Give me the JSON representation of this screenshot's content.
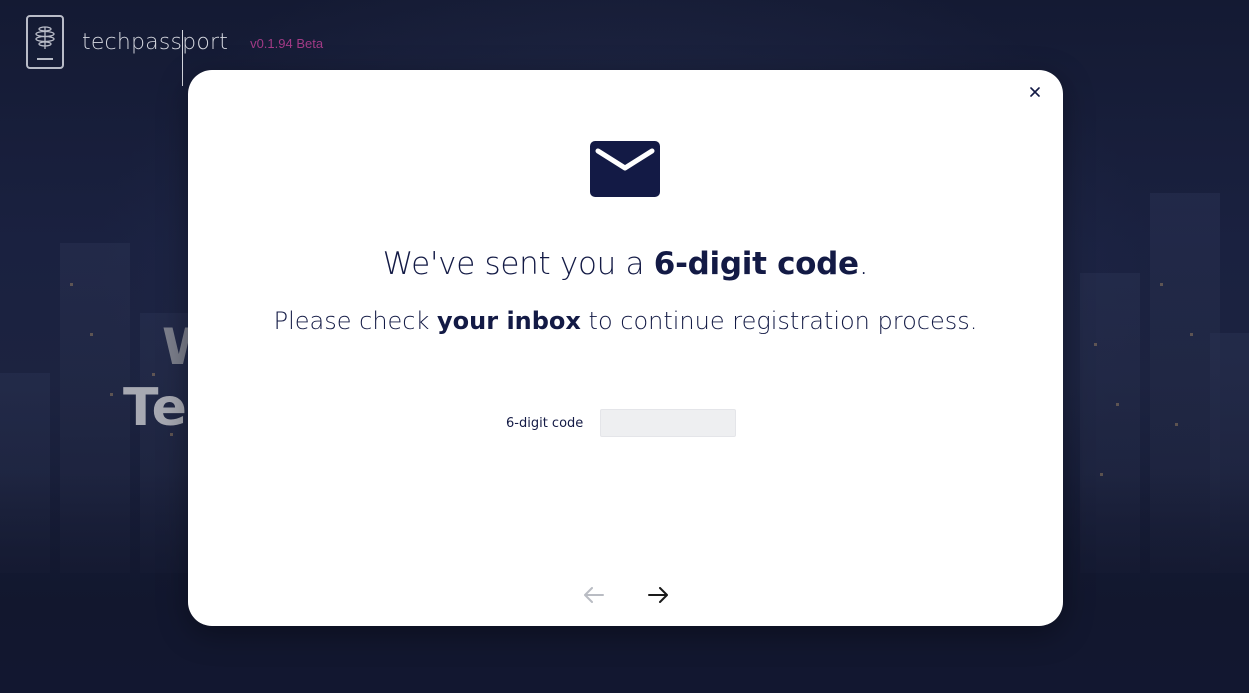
{
  "header": {
    "brand": "techpassport",
    "version": "v0.1.94 Beta",
    "logo_icon": "passport-logo-icon"
  },
  "hero": {
    "line1": "W",
    "line2": "Te"
  },
  "modal": {
    "close_icon": "close-icon",
    "mail_icon": "envelope-icon",
    "headline_pre": "We've sent you a ",
    "headline_bold": "6-digit code",
    "headline_post": ".",
    "sub_pre": "Please check ",
    "sub_bold": "your inbox",
    "sub_post": " to continue registration process.",
    "code_label": "6-digit code",
    "code_value": "",
    "code_placeholder": "",
    "prev_icon": "arrow-left-icon",
    "next_icon": "arrow-right-icon"
  },
  "colors": {
    "brand_navy": "#131a45",
    "version_magenta": "#a23a86",
    "background": "#141a33",
    "input_bg": "#eeeff1",
    "disabled_arrow": "#b9bcc3"
  }
}
